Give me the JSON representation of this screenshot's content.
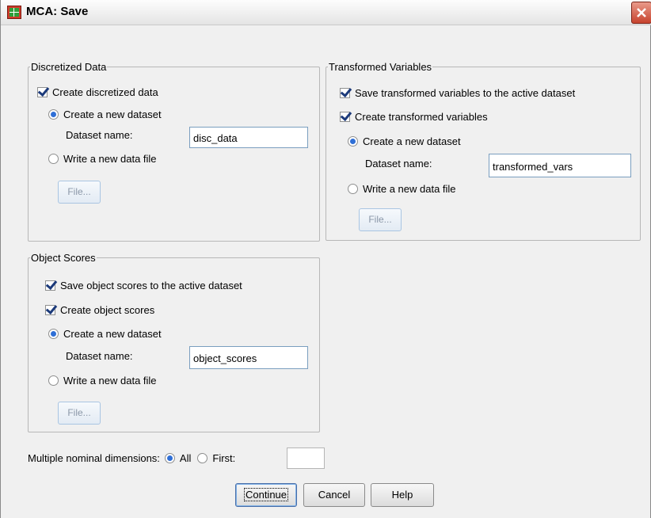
{
  "window": {
    "title": "MCA: Save"
  },
  "discretized": {
    "legend": "Discretized Data",
    "create_label": "Create discretized data",
    "new_dataset_label": "Create a new dataset",
    "dataset_name_label": "Dataset name:",
    "dataset_name_value": "disc_data",
    "write_file_label": "Write a new data file",
    "file_button": "File..."
  },
  "transformed": {
    "legend": "Transformed Variables",
    "save_label": "Save transformed variables to the active dataset",
    "create_label": "Create transformed variables",
    "new_dataset_label": "Create a new dataset",
    "dataset_name_label": "Dataset name:",
    "dataset_name_value": "transformed_vars",
    "write_file_label": "Write a new data file",
    "file_button": "File..."
  },
  "object_scores": {
    "legend": "Object Scores",
    "save_label": "Save object scores to the active dataset",
    "create_label": "Create object scores",
    "new_dataset_label": "Create a new dataset",
    "dataset_name_label": "Dataset name:",
    "dataset_name_value": "object_scores",
    "write_file_label": "Write a new data file",
    "file_button": "File..."
  },
  "dimensions": {
    "label": "Multiple nominal dimensions:",
    "all_label": "All",
    "first_label": "First:",
    "first_value": ""
  },
  "buttons": {
    "continue": "Continue",
    "cancel": "Cancel",
    "help": "Help"
  }
}
